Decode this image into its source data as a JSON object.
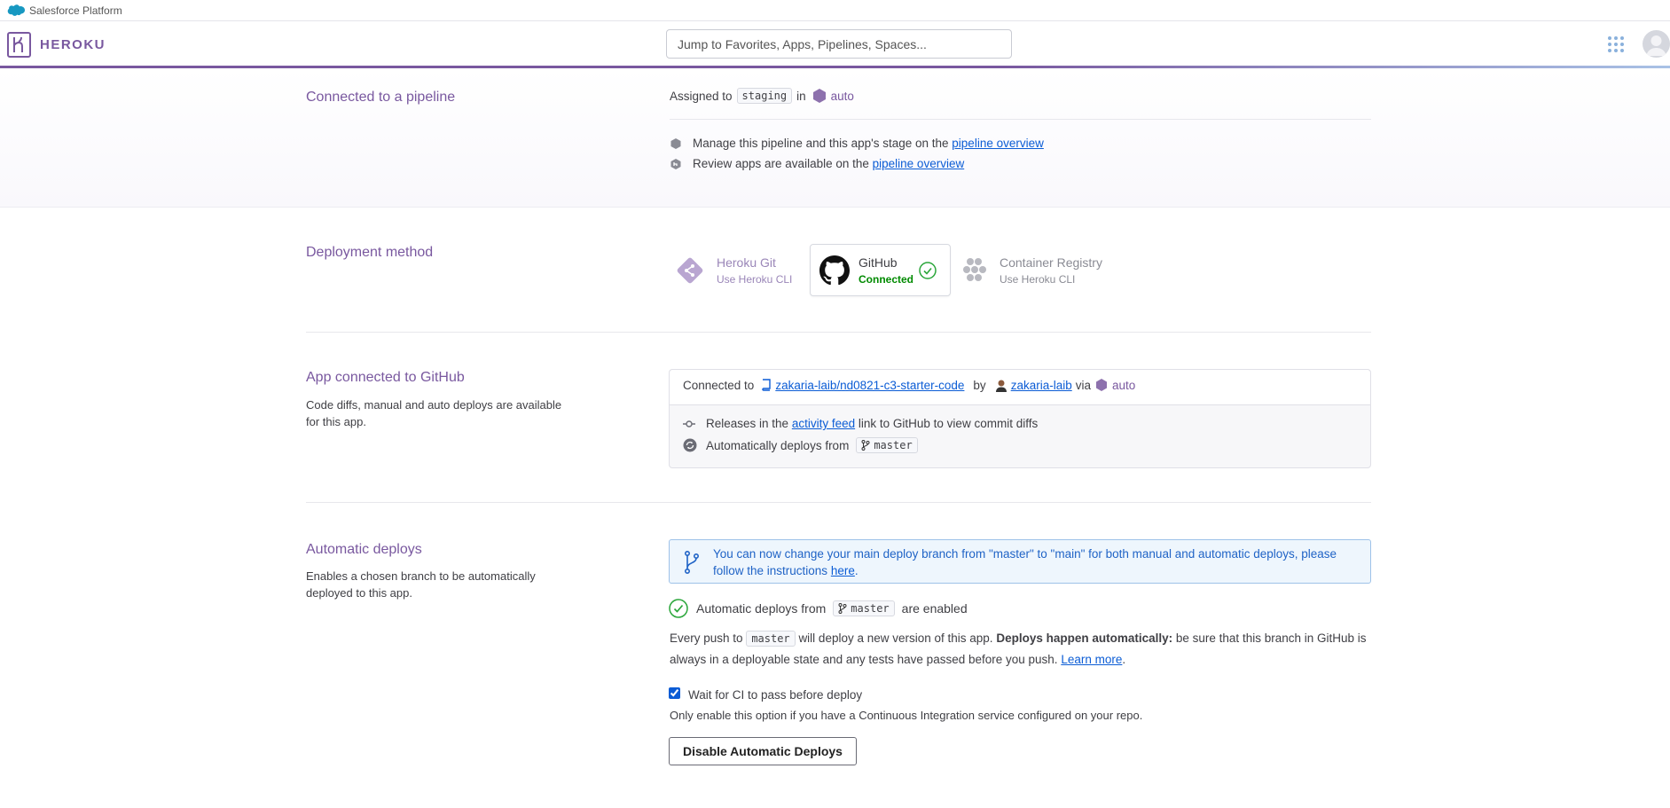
{
  "topbar": {
    "salesforce_label": "Salesforce Platform"
  },
  "header": {
    "brand": "HEROKU",
    "search_placeholder": "Jump to Favorites, Apps, Pipelines, Spaces..."
  },
  "pipeline": {
    "title": "Connected to a pipeline",
    "assigned_prefix": "Assigned to",
    "stage": "staging",
    "in_label": "in",
    "pipeline_name": "auto",
    "manage_text": "Manage this pipeline and this app's stage on the",
    "manage_link": "pipeline overview",
    "review_text": "Review apps are available on the",
    "review_link": "pipeline overview"
  },
  "deployment": {
    "title": "Deployment method",
    "methods": [
      {
        "name": "Heroku Git",
        "sub": "Use Heroku CLI"
      },
      {
        "name": "GitHub",
        "sub": "Connected"
      },
      {
        "name": "Container Registry",
        "sub": "Use Heroku CLI"
      }
    ]
  },
  "github": {
    "title": "App connected to GitHub",
    "desc": "Code diffs, manual and auto deploys are available for this app.",
    "connected_to": "Connected to",
    "repo": "zakaria-laib/nd0821-c3-starter-code",
    "by": "by",
    "user": "zakaria-laib",
    "via": "via",
    "via_pipeline": "auto",
    "releases_pre": "Releases in the",
    "releases_link": "activity feed",
    "releases_post": "link to GitHub to view commit diffs",
    "auto_from": "Automatically deploys from",
    "branch": "master"
  },
  "auto": {
    "title": "Automatic deploys",
    "desc": "Enables a chosen branch to be automatically deployed to this app.",
    "banner_text": "You can now change your main deploy branch from \"master\" to \"main\" for both manual and automatic deploys, please follow the instructions",
    "banner_link": "here",
    "banner_end": ".",
    "enabled_pre": "Automatic deploys from",
    "branch": "master",
    "enabled_post": "are enabled",
    "push_pre": "Every push to",
    "push_branch": "master",
    "push_mid": "will deploy a new version of this app.",
    "push_bold": "Deploys happen automatically:",
    "push_post": "be sure that this branch in GitHub is always in a deployable state and any tests have passed before you push.",
    "learn_more": "Learn more",
    "period": ".",
    "ci_label": "Wait for CI to pass before deploy",
    "ci_checked": true,
    "ci_note": "Only enable this option if you have a Continuous Integration service configured on your repo.",
    "disable_button": "Disable Automatic Deploys"
  }
}
